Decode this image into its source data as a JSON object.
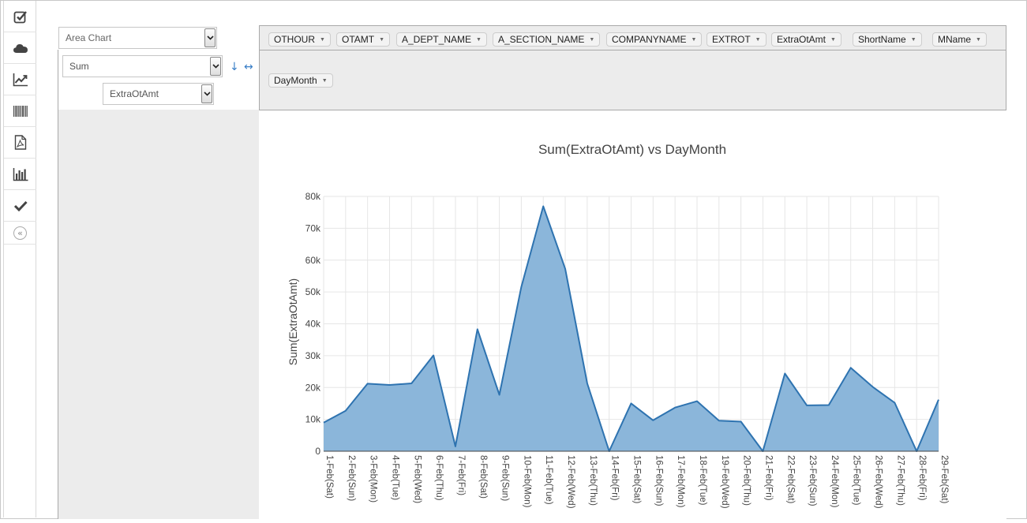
{
  "sidebar": {
    "items": [
      {
        "icon": "checkbox-icon"
      },
      {
        "icon": "cloud-icon"
      },
      {
        "icon": "line-chart-icon"
      },
      {
        "icon": "barcode-icon"
      },
      {
        "icon": "pdf-icon"
      },
      {
        "icon": "bar-chart-icon"
      },
      {
        "icon": "checkmark-icon"
      }
    ],
    "collapse_glyph": "«"
  },
  "controls": {
    "renderer": "Area Chart",
    "aggregator": "Sum",
    "aggregator_attr": "ExtraOtAmt",
    "sort_glyph": "↓",
    "swap_glyph": "↔"
  },
  "attributes": [
    {
      "label": "OTHOUR"
    },
    {
      "label": "OTAMT"
    },
    {
      "label": "A_DEPT_NAME"
    },
    {
      "label": "A_SECTION_NAME"
    },
    {
      "label": "COMPANYNAME"
    },
    {
      "label": "EXTROT"
    },
    {
      "label": "ExtraOtAmt"
    },
    {
      "label": "ShortName"
    },
    {
      "label": "MName"
    }
  ],
  "columns": [
    {
      "label": "DayMonth"
    }
  ],
  "pill_caret": "▼",
  "colors": {
    "area_fill": "#8bb6da",
    "area_line": "#2e73b0",
    "grid": "#e6e6e6"
  },
  "chart_data": {
    "type": "area",
    "title": "Sum(ExtraOtAmt) vs DayMonth",
    "xlabel": "",
    "ylabel": "Sum(ExtraOtAmt)",
    "ylim": [
      0,
      80000
    ],
    "yticks": [
      0,
      10000,
      20000,
      30000,
      40000,
      50000,
      60000,
      70000,
      80000
    ],
    "ytick_labels": [
      "0",
      "10k",
      "20k",
      "30k",
      "40k",
      "50k",
      "60k",
      "70k",
      "80k"
    ],
    "grid": true,
    "categories": [
      "1-Feb(Sat)",
      "2-Feb(Sun)",
      "3-Feb(Mon)",
      "4-Feb(Tue)",
      "5-Feb(Wed)",
      "6-Feb(Thu)",
      "7-Feb(Fri)",
      "8-Feb(Sat)",
      "9-Feb(Sun)",
      "10-Feb(Mon)",
      "11-Feb(Tue)",
      "12-Feb(Wed)",
      "13-Feb(Thu)",
      "14-Feb(Fri)",
      "15-Feb(Sat)",
      "16-Feb(Sun)",
      "17-Feb(Mon)",
      "18-Feb(Tue)",
      "19-Feb(Wed)",
      "20-Feb(Thu)",
      "21-Feb(Fri)",
      "22-Feb(Sat)",
      "23-Feb(Sun)",
      "24-Feb(Mon)",
      "25-Feb(Tue)",
      "26-Feb(Wed)",
      "27-Feb(Thu)",
      "28-Feb(Fri)",
      "29-Feb(Sat)"
    ],
    "values": [
      9000,
      12700,
      21200,
      20800,
      21300,
      30100,
      1500,
      38300,
      17700,
      51600,
      76900,
      57300,
      21300,
      0,
      15000,
      9700,
      13700,
      15700,
      9600,
      9300,
      0,
      24400,
      14400,
      14500,
      26200,
      20200,
      15200,
      0,
      16200
    ]
  }
}
